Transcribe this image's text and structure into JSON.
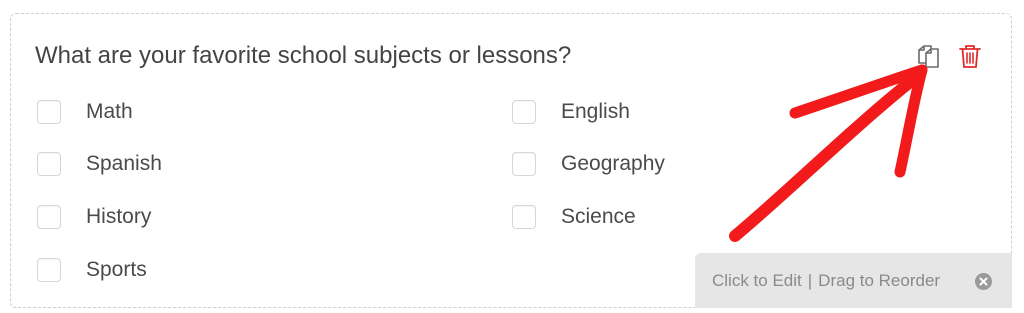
{
  "field": {
    "question": "What are your favorite school subjects or lessons?",
    "options": [
      "Math",
      "English",
      "Spanish",
      "Geography",
      "History",
      "Science",
      "Sports"
    ]
  },
  "actions": {
    "duplicate_icon": "duplicate-icon",
    "delete_icon": "trash-icon"
  },
  "edit_bar": {
    "click_text": "Click to Edit",
    "separator": "|",
    "drag_text": "Drag to Reorder",
    "close_icon": "close-circle-icon"
  },
  "colors": {
    "delete": "#e02b2b",
    "annotation_arrow": "#f21a1a",
    "edit_bar_background": "#e6e6e6",
    "text": "#444444"
  }
}
